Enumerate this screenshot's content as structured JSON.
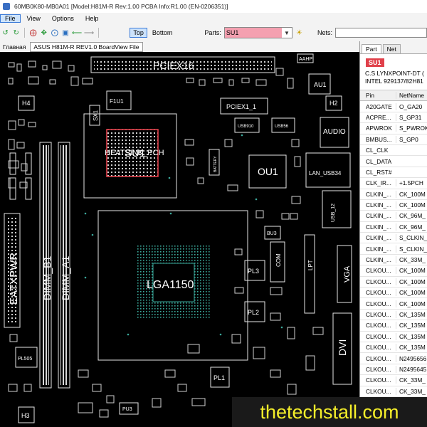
{
  "window": {
    "title": "60MB0K80-MB0A01 [Model:H81M-R Rev:1.00 PCBA Info:R1.00 (EN-0206351)]"
  },
  "menu": [
    "File",
    "View",
    "Options",
    "Help"
  ],
  "toolbar": {
    "top_label": "Top",
    "bottom_label": "Bottom",
    "parts_label": "Parts:",
    "parts_value": "SU1",
    "nets_label": "Nets:",
    "nets_value": ""
  },
  "tabs": {
    "home_label": "Главная",
    "file_tab": "ASUS H81M-R REV1.0 BoardView File"
  },
  "panel": {
    "tabs": [
      "Part",
      "Net"
    ],
    "part_name": "SU1",
    "desc_line1": "C.S LYNXPOINT-DT (",
    "desc_line2": "INTEL 929137/82H81",
    "headers": [
      "Pin",
      "NetName"
    ],
    "rows": [
      [
        "A20GATE",
        "O_GA20"
      ],
      [
        "ACPRE...",
        "S_GP31"
      ],
      [
        "APWROK",
        "S_PWROK"
      ],
      [
        "BMBUS...",
        "S_GP0"
      ],
      [
        "CL_CLK",
        ""
      ],
      [
        "CL_DATA",
        ""
      ],
      [
        "CL_RST#",
        ""
      ],
      [
        "CLK_IR...",
        "+1.5PCH"
      ],
      [
        "CLKIN_...",
        "CK_100M"
      ],
      [
        "CLKIN_...",
        "CK_100M"
      ],
      [
        "CLKIN_...",
        "CK_96M_"
      ],
      [
        "CLKIN_...",
        "CK_96M_"
      ],
      [
        "CLKIN_...",
        "S_CLKIN_"
      ],
      [
        "CLKIN_...",
        "S_CLKIN_"
      ],
      [
        "CLKIN_...",
        "CK_33M_"
      ],
      [
        "CLKOU...",
        "CK_100M"
      ],
      [
        "CLKOU...",
        "CK_100M"
      ],
      [
        "CLKOU...",
        "CK_100M"
      ],
      [
        "CLKOU...",
        "CK_100M"
      ],
      [
        "CLKOU...",
        "CK_135M"
      ],
      [
        "CLKOU...",
        "CK_135M"
      ],
      [
        "CLKOU...",
        "CK_135M"
      ],
      [
        "CLKOU...",
        "CK_135M"
      ],
      [
        "CLKOU...",
        "N2495656"
      ],
      [
        "CLKOU...",
        "N2495645"
      ],
      [
        "CLKOU...",
        "CK_33M_"
      ],
      [
        "CLKOU...",
        "CK_33M_"
      ],
      [
        "CLKOU...",
        "CK_33M_"
      ],
      [
        "CLKOU...",
        ""
      ]
    ]
  },
  "board_labels": {
    "pciex16": "PCIEX16",
    "pciex1": "PCIEX1_1",
    "su1": "SU1",
    "heatsink": "HEATSINK_PCH",
    "ou1": "OU1",
    "lga": "LGA1150",
    "eatxpwr": "EATXPWR",
    "dimm_b1": "DIMM_B1",
    "dimm_a1": "DIMM_A1",
    "audio": "AUDIO",
    "lan": "LAN_USB34",
    "vga": "VGA",
    "dvi": "DVI",
    "lpt": "LPT",
    "com": "COM",
    "au1": "AU1",
    "h1": "H1",
    "h2": "H2",
    "h3": "H3",
    "h4": "H4",
    "f1u1": "F1U1",
    "sx1": "SX1",
    "bu3": "BU3",
    "pl1": "PL1",
    "pl2": "PL2",
    "pl3": "PL3",
    "pu3": "PU3",
    "pl505": "PL505",
    "aahp": "AAHP",
    "usb910": "USB910",
    "usb56": "USB56",
    "usb12": "USB_12",
    "battery": "BATTERY"
  },
  "watermark": "thetechstall.com",
  "colors": {
    "board": "#000000",
    "outline": "#e0e0e0",
    "highlight": "#e0404a",
    "parts_field": "#f4a0b0",
    "teal": "#3aa89a",
    "watermark_text": "#f5ef2a"
  }
}
